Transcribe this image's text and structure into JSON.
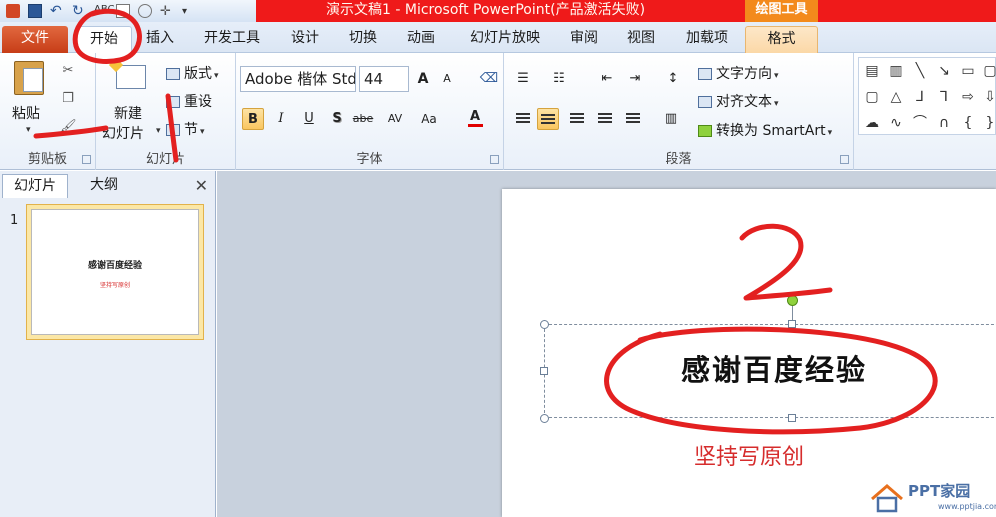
{
  "window": {
    "title": "演示文稿1 - Microsoft PowerPoint(产品激活失败)",
    "context_group": "绘图工具"
  },
  "tabs": [
    {
      "label": "文件"
    },
    {
      "label": "开始"
    },
    {
      "label": "插入"
    },
    {
      "label": "开发工具"
    },
    {
      "label": "设计"
    },
    {
      "label": "切换"
    },
    {
      "label": "动画"
    },
    {
      "label": "幻灯片放映"
    },
    {
      "label": "审阅"
    },
    {
      "label": "视图"
    },
    {
      "label": "加载项"
    },
    {
      "label": "格式"
    }
  ],
  "ribbon": {
    "clipboard": {
      "paste": "粘贴",
      "group": "剪贴板"
    },
    "slides": {
      "new_slide_line1": "新建",
      "new_slide_line2": "幻灯片",
      "layout": "版式",
      "reset": "重设",
      "section": "节",
      "group": "幻灯片"
    },
    "font": {
      "font_name": "Adobe 楷体 Std R",
      "font_size": "44",
      "group": "字体",
      "bold": "B",
      "italic": "I",
      "underline": "U",
      "shadow": "S",
      "strike": "abe",
      "spacing": "AV",
      "case": "Aa",
      "color": "A",
      "grow": "A",
      "shrink": "A"
    },
    "paragraph": {
      "text_direction": "文字方向",
      "align_text": "对齐文本",
      "smartart": "转换为 SmartArt",
      "group": "段落"
    }
  },
  "left_panel": {
    "tabs": [
      "幻灯片",
      "大纲"
    ],
    "close": "✕",
    "slides": [
      {
        "number": "1",
        "title": "感谢百度经验",
        "subtitle": "坚持写原创"
      }
    ]
  },
  "slide": {
    "title": "感谢百度经验",
    "subtitle": "坚持写原创"
  },
  "watermark": {
    "brand": "PPT家园",
    "url": "www.pptjia.com"
  },
  "colors": {
    "title_bar_red": "#ef1a1a",
    "context_orange": "#f38a1c",
    "file_tab": "#d24726",
    "subtitle_red": "#d62c2c",
    "annotation_red": "#e32020"
  }
}
